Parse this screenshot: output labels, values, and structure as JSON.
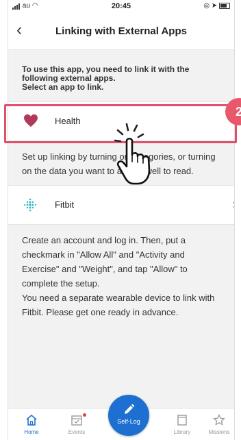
{
  "status_bar": {
    "carrier": "au",
    "time": "20:45"
  },
  "header": {
    "title": "Linking with External Apps"
  },
  "intro": {
    "line1": "To use this app, you need to link it with the",
    "line2": "following external apps.",
    "line3": "Select an app to link."
  },
  "apps": [
    {
      "name": "Health",
      "description": "Set up linking by turning on categories, or turning on the data you want to allow &well to read."
    },
    {
      "name": "Fitbit",
      "description_1": "Create an account and log in. Then, put a checkmark in \"Allow All\" and \"Activity and Exercise\" and \"Weight\", and tap \"Allow\" to complete the setup.",
      "description_2": "You need a separate wearable device to link with Fitbit. Please get one ready in advance."
    }
  ],
  "step_badge": "2",
  "tabs": {
    "home": "Home",
    "events": "Events",
    "self_log": "Self-Log",
    "library": "Library",
    "missions": "Missions"
  },
  "colors": {
    "accent": "#1d6fd1",
    "highlight": "#e0506b",
    "health_heart": "#b03a5a",
    "fitbit": "#33b8c4"
  }
}
